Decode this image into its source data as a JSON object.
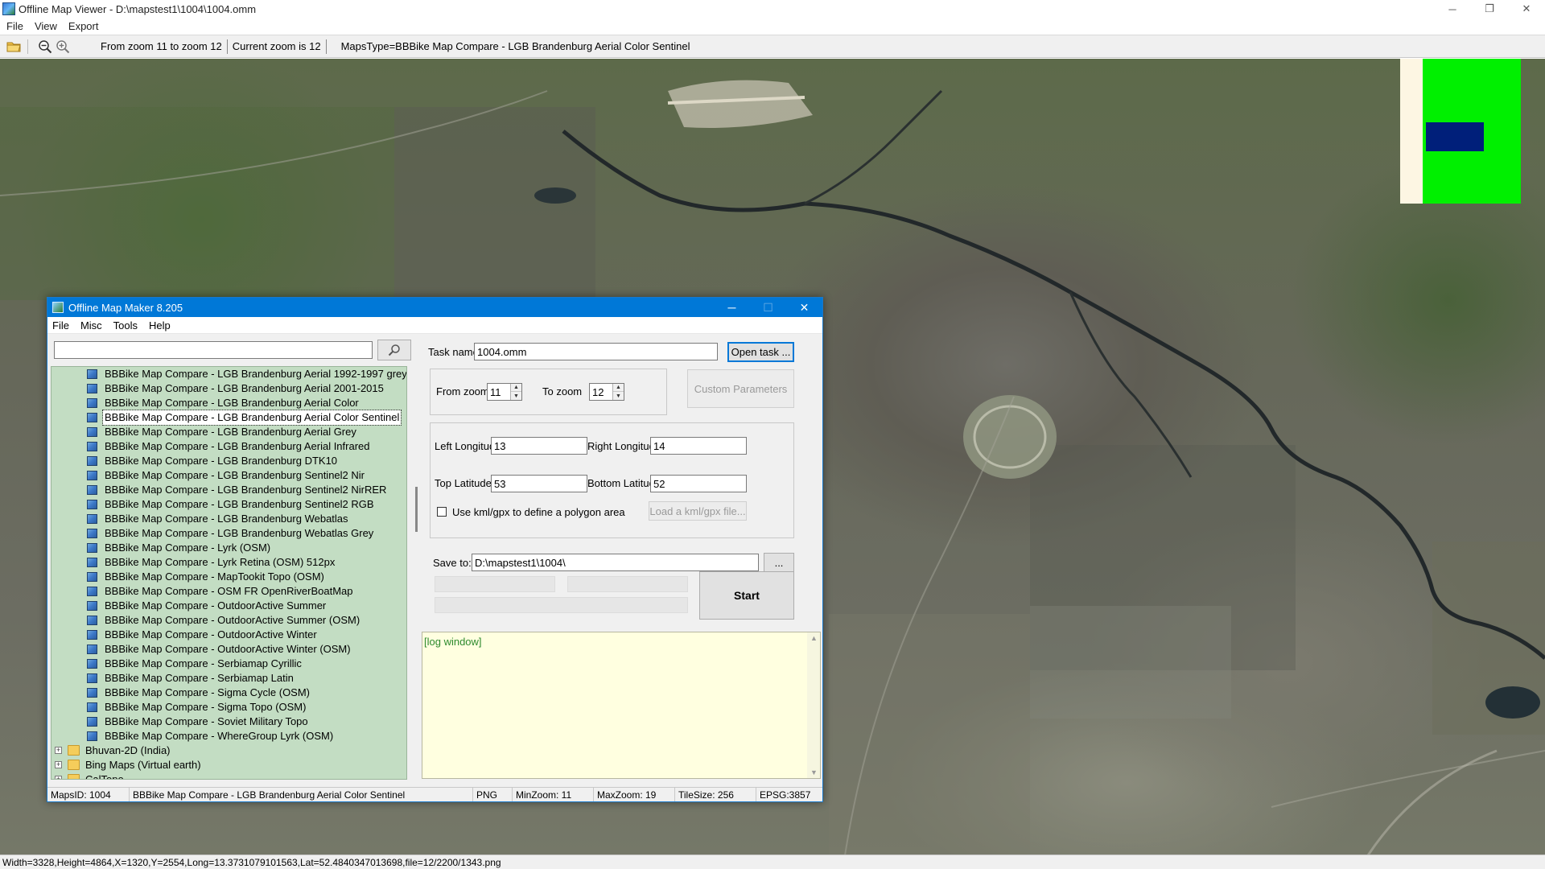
{
  "viewer": {
    "title": "Offline Map Viewer - D:\\mapstest1\\1004\\1004.omm",
    "menu": [
      "File",
      "View",
      "Export"
    ],
    "toolbar": {
      "zoom_range": "From zoom 11 to zoom 12",
      "current_zoom": "Current zoom is 12",
      "maps_type": "MapsType=BBBike Map Compare - LGB Brandenburg Aerial Color Sentinel"
    },
    "status": "Width=3328,Height=4864,X=1320,Y=2554,Long=13.3731079101563,Lat=52.4840347013698,file=12/2200/1343.png",
    "window_controls": [
      "─",
      "❐",
      "✕"
    ]
  },
  "minimap": {
    "colors": {
      "background": "#fdf6e3",
      "coverage": "#00f000",
      "viewport": "#001f7a"
    }
  },
  "dialog": {
    "title": "Offline Map Maker 8.205",
    "menu": [
      "File",
      "Misc",
      "Tools",
      "Help"
    ],
    "search": {
      "value": "",
      "placeholder": ""
    },
    "tree": {
      "items": [
        "BBBike Map Compare - LGB Brandenburg Aerial 1992-1997 grey",
        "BBBike Map Compare - LGB Brandenburg Aerial 2001-2015",
        "BBBike Map Compare - LGB Brandenburg Aerial Color",
        "BBBike Map Compare - LGB Brandenburg Aerial Color Sentinel",
        "BBBike Map Compare - LGB Brandenburg Aerial Grey",
        "BBBike Map Compare - LGB Brandenburg Aerial Infrared",
        "BBBike Map Compare - LGB Brandenburg DTK10",
        "BBBike Map Compare - LGB Brandenburg Sentinel2 Nir",
        "BBBike Map Compare - LGB Brandenburg Sentinel2 NirRER",
        "BBBike Map Compare - LGB Brandenburg Sentinel2 RGB",
        "BBBike Map Compare - LGB Brandenburg Webatlas",
        "BBBike Map Compare - LGB Brandenburg Webatlas Grey",
        "BBBike Map Compare - Lyrk (OSM)",
        "BBBike Map Compare - Lyrk Retina (OSM) 512px",
        "BBBike Map Compare - MapTookit Topo (OSM)",
        "BBBike Map Compare - OSM FR OpenRiverBoatMap",
        "BBBike Map Compare - OutdoorActive Summer",
        "BBBike Map Compare - OutdoorActive Summer (OSM)",
        "BBBike Map Compare - OutdoorActive Winter",
        "BBBike Map Compare - OutdoorActive Winter (OSM)",
        "BBBike Map Compare - Serbiamap Cyrillic",
        "BBBike Map Compare - Serbiamap Latin",
        "BBBike Map Compare - Sigma Cycle (OSM)",
        "BBBike Map Compare - Sigma Topo (OSM)",
        "BBBike Map Compare - Soviet Military Topo",
        "BBBike Map Compare - WhereGroup Lyrk (OSM)"
      ],
      "selected": "BBBike Map Compare - LGB Brandenburg Aerial Color Sentinel",
      "folders": [
        "Bhuvan-2D (India)",
        "Bing Maps (Virtual earth)",
        "CalTopo"
      ],
      "expander_symbol": "+"
    },
    "task": {
      "task_name_label": "Task name",
      "task_name_value": "1004.omm",
      "open_task_label": "Open task ...",
      "from_zoom_label": "From zoom",
      "from_zoom_value": "11",
      "to_zoom_label": "To zoom",
      "to_zoom_value": "12",
      "custom_params_label": "Custom Parameters",
      "left_lon_label": "Left Longitude",
      "left_lon_value": "13",
      "right_lon_label": "Right Longitude",
      "right_lon_value": "14",
      "top_lat_label": "Top Latitude",
      "top_lat_value": "53",
      "bottom_lat_label": "Bottom Latitude",
      "bottom_lat_value": "52",
      "kml_checkbox_label": "Use kml/gpx to define a polygon area",
      "load_kml_label": "Load a kml/gpx file...",
      "save_to_label": "Save to:",
      "save_to_value": "D:\\mapstest1\\1004\\",
      "browse_label": "...",
      "start_label": "Start",
      "log_text": "[log window]"
    },
    "status": {
      "maps_id": "MapsID: 1004",
      "maps_name": "BBBike Map Compare - LGB Brandenburg Aerial Color Sentinel",
      "format": "PNG",
      "min_zoom": "MinZoom: 11",
      "max_zoom": "MaxZoom: 19",
      "tile_size": "TileSize: 256",
      "epsg": "EPSG:3857"
    },
    "window_controls": [
      "─",
      "☐",
      "✕"
    ]
  }
}
